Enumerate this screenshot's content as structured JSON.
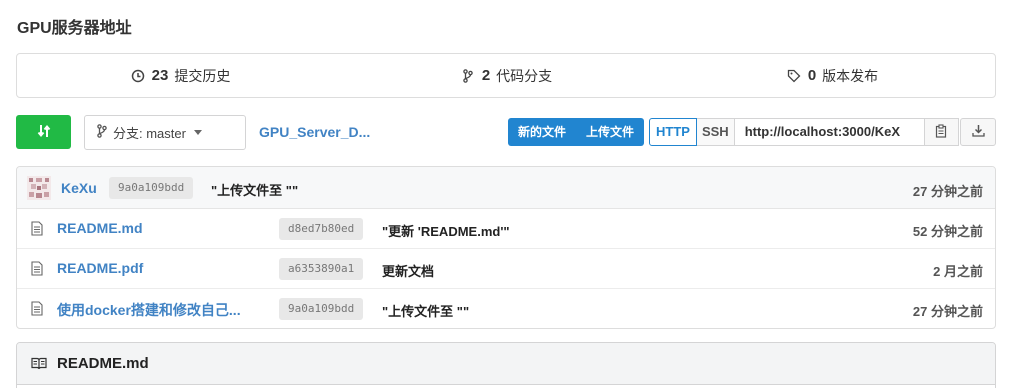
{
  "repo": {
    "title": "GPU服务器地址"
  },
  "stats": {
    "commits": {
      "count": "23",
      "label": "提交历史",
      "icon": "history-icon"
    },
    "branches": {
      "count": "2",
      "label": "代码分支",
      "icon": "branch-icon"
    },
    "releases": {
      "count": "0",
      "label": "版本发布",
      "icon": "tag-icon"
    }
  },
  "toolbar": {
    "branch_label": "分支: master",
    "repo_link": "GPU_Server_D...",
    "new_file": "新的文件",
    "upload_file": "上传文件",
    "http": "HTTP",
    "ssh": "SSH",
    "clone_url": "http://localhost:3000/KeX"
  },
  "latest_commit": {
    "author": "KeXu",
    "sha": "9a0a109bdd",
    "message": "\"上传文件至 \"\"",
    "age": "27 分钟之前"
  },
  "files": [
    {
      "name": "README.md",
      "sha": "d8ed7b80ed",
      "message": "\"更新 'README.md'\"",
      "age": "52 分钟之前"
    },
    {
      "name": "README.pdf",
      "sha": "a6353890a1",
      "message": "更新文档",
      "age": "2 月之前"
    },
    {
      "name": "使用docker搭建和修改自己...",
      "sha": "9a0a109bdd",
      "message": "\"上传文件至 \"\"",
      "age": "27 分钟之前"
    }
  ],
  "readme": {
    "title": "README.md"
  },
  "colors": {
    "accent": "#2185d0",
    "green": "#21ba45",
    "link": "#4183c4"
  }
}
